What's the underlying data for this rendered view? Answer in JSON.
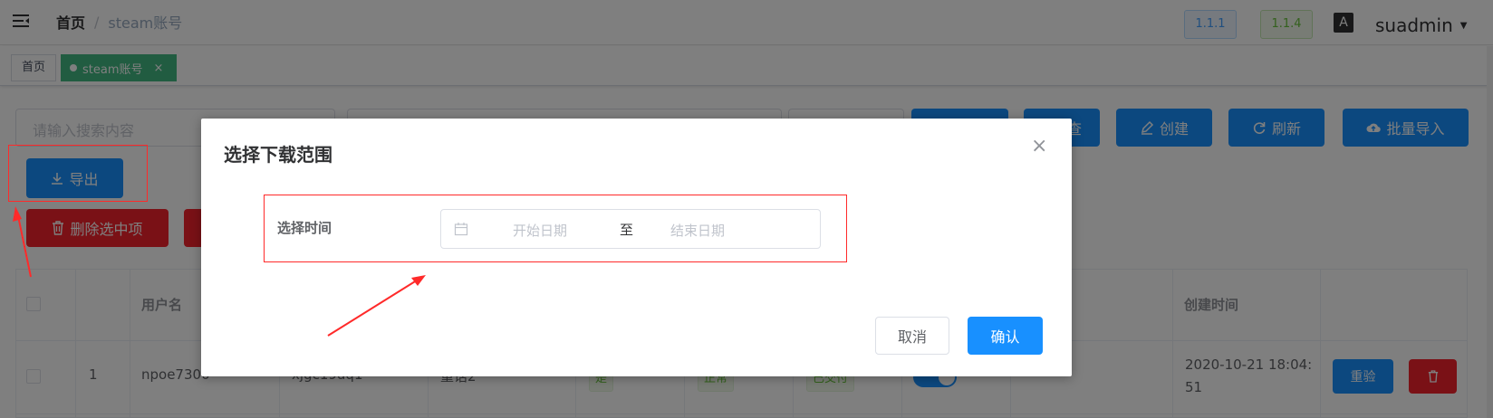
{
  "header": {
    "breadcrumb_home": "首页",
    "breadcrumb_sep": "/",
    "breadcrumb_current": "steam账号",
    "version_1": "1.1.1",
    "version_2": "1.1.4",
    "username": "suadmin"
  },
  "tabs": {
    "home": "首页",
    "active": "steam账号",
    "close_glyph": "×"
  },
  "toolbar": {
    "search_placeholder": "请输入搜索内容",
    "range_sep_fragment": "至",
    "create": "创建",
    "refresh": "刷新",
    "batch_import": "批量导入",
    "export": "导出",
    "delete_selected": "删除选中项",
    "hidden_fragment": "查"
  },
  "table": {
    "headers": {
      "username": "用户名",
      "created_at": "创建时间"
    },
    "rows": [
      {
        "index": "1",
        "username": "npoe7300",
        "password": "xjgc19dq1",
        "region": "重话2",
        "tag1": "是",
        "tag2": "正常",
        "tag3": "已交付",
        "created_at_line1": "2020-10-21 18:04:",
        "created_at_line2": "51",
        "action_recheck": "重验"
      }
    ]
  },
  "dialog": {
    "title": "选择下载范围",
    "close_glyph": "×",
    "field_label": "选择时间",
    "start_placeholder": "开始日期",
    "range_separator": "至",
    "end_placeholder": "结束日期",
    "cancel": "取消",
    "confirm": "确认"
  },
  "colors": {
    "primary": "#1890ff",
    "danger": "#f5222d",
    "tab_active": "#42b983",
    "annotation": "#ff0000"
  }
}
